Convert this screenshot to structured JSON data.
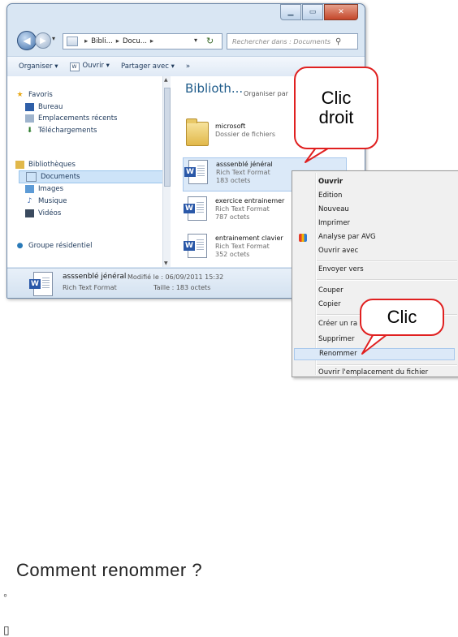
{
  "window": {
    "caption_buttons": [
      "minimize",
      "maximize",
      "close"
    ]
  },
  "address_bar": {
    "crumbs": [
      "Bibli...",
      "Docu..."
    ],
    "search_placeholder": "Rechercher dans : Documents"
  },
  "toolbar": {
    "organize": "Organiser ▾",
    "open": "Ouvrir ▾",
    "share": "Partager avec ▾",
    "more": "»"
  },
  "nav": {
    "favorites": "Favoris",
    "desktop": "Bureau",
    "recent": "Emplacements récents",
    "downloads": "Téléchargements",
    "libraries": "Bibliothèques",
    "documents": "Documents",
    "images": "Images",
    "music": "Musique",
    "videos": "Vidéos",
    "homegroup": "Groupe résidentiel"
  },
  "content": {
    "title": "Biblioth...",
    "arrange": "Organiser par",
    "files": [
      {
        "name": "microsoft",
        "type": "Dossier de fichiers",
        "size": ""
      },
      {
        "name": "asssenblé jénéral",
        "type": "Rich Text Format",
        "size": "183 octets"
      },
      {
        "name": "exercice entrainemer",
        "type": "Rich Text Format",
        "size": "787 octets"
      },
      {
        "name": "entrainement clavier",
        "type": "Rich Text Format",
        "size": "352 octets"
      }
    ]
  },
  "details": {
    "name": "asssenblé jénéral",
    "modified": "Modifié le : 06/09/2011 15:32",
    "type": "Rich Text Format",
    "size": "Taille : 183 octets"
  },
  "context_menu": {
    "open": "Ouvrir",
    "edit": "Edition",
    "new": "Nouveau",
    "print": "Imprimer",
    "avg": "Analyse par AVG",
    "open_with": "Ouvrir avec",
    "send_to": "Envoyer vers",
    "cut": "Couper",
    "copy": "Copier",
    "create_shortcut": "Créer un ra",
    "delete": "Supprimer",
    "rename": "Renommer",
    "open_location": "Ouvrir l'emplacement du fichier"
  },
  "callouts": {
    "right_click_1": "Clic",
    "right_click_2": "droit",
    "click": "Clic"
  },
  "background_doc": {
    "heading": "Comment renommer ?",
    "bullet_1": "◦",
    "bullet_2": "▯"
  }
}
